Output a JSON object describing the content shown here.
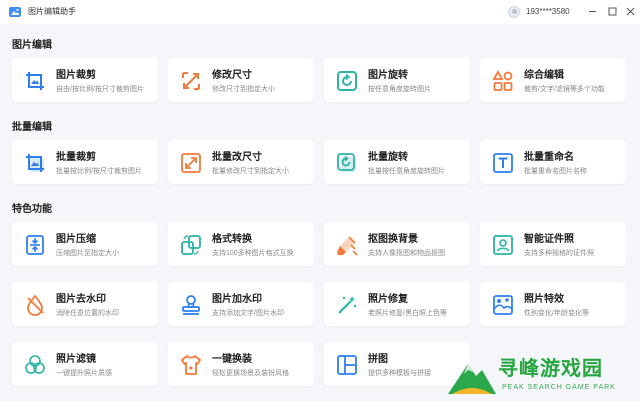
{
  "app": {
    "title": "图片编辑助手",
    "username": "193****3580"
  },
  "colors": {
    "blue": "#2d7ff0",
    "orange": "#f07a3a",
    "teal": "#2bb3a6"
  },
  "sections": [
    {
      "title": "图片编辑"
    },
    {
      "title": "批量编辑"
    },
    {
      "title": "特色功能"
    }
  ],
  "cards": {
    "crop": {
      "title": "图片裁剪",
      "desc": "自由/按比例/按尺寸裁剪图片",
      "icon": "crop-icon"
    },
    "resize": {
      "title": "修改尺寸",
      "desc": "修改尺寸到指定大小",
      "icon": "resize-arrows-icon"
    },
    "rotate": {
      "title": "图片旋转",
      "desc": "按任意角度旋转图片",
      "icon": "rotate-icon"
    },
    "combo": {
      "title": "综合编辑",
      "desc": "裁剪/文字/滤镜等多个功能",
      "icon": "shapes-icon"
    },
    "batch_crop": {
      "title": "批量裁剪",
      "desc": "批量按比例/按尺寸裁剪图片",
      "icon": "batch-crop-icon"
    },
    "batch_resize": {
      "title": "批量改尺寸",
      "desc": "批量修改尺寸到指定大小",
      "icon": "batch-resize-icon"
    },
    "batch_rotate": {
      "title": "批量旋转",
      "desc": "批量按任意角度旋转图片",
      "icon": "batch-rotate-icon"
    },
    "batch_rename": {
      "title": "批量重命名",
      "desc": "批量重命名图片名称",
      "icon": "text-t-icon"
    },
    "compress": {
      "title": "图片压缩",
      "desc": "压缩图片至指定大小",
      "icon": "compress-icon"
    },
    "convert": {
      "title": "格式转换",
      "desc": "支持100多种图片格式互换",
      "icon": "convert-icon"
    },
    "cutout": {
      "title": "抠图换背景",
      "desc": "支持人像抠图和物品抠图",
      "icon": "eraser-icon"
    },
    "id_photo": {
      "title": "智能证件照",
      "desc": "支持多种规格的证件照",
      "icon": "id-photo-icon"
    },
    "watermark_remove": {
      "title": "图片去水印",
      "desc": "消除任意位置的水印",
      "icon": "drop-icon"
    },
    "watermark_add": {
      "title": "图片加水印",
      "desc": "支持添加文字/图片水印",
      "icon": "stamp-icon"
    },
    "repair": {
      "title": "照片修复",
      "desc": "老照片修复/黑白照上色等",
      "icon": "magic-wand-icon"
    },
    "effects": {
      "title": "照片特效",
      "desc": "性别变化/年龄变化等",
      "icon": "face-effect-icon"
    },
    "filter": {
      "title": "照片滤镜",
      "desc": "一键提升照片质感",
      "icon": "filter-circles-icon"
    },
    "outfit": {
      "title": "一键换装",
      "desc": "轻松更换场景及装扮风格",
      "icon": "shirt-icon"
    },
    "collage": {
      "title": "拼图",
      "desc": "提供多种模板与拼接",
      "icon": "collage-grid-icon"
    }
  },
  "watermark": {
    "text": "寻峰游戏园",
    "sub": "PEAK SEARCH GAME PARK"
  }
}
